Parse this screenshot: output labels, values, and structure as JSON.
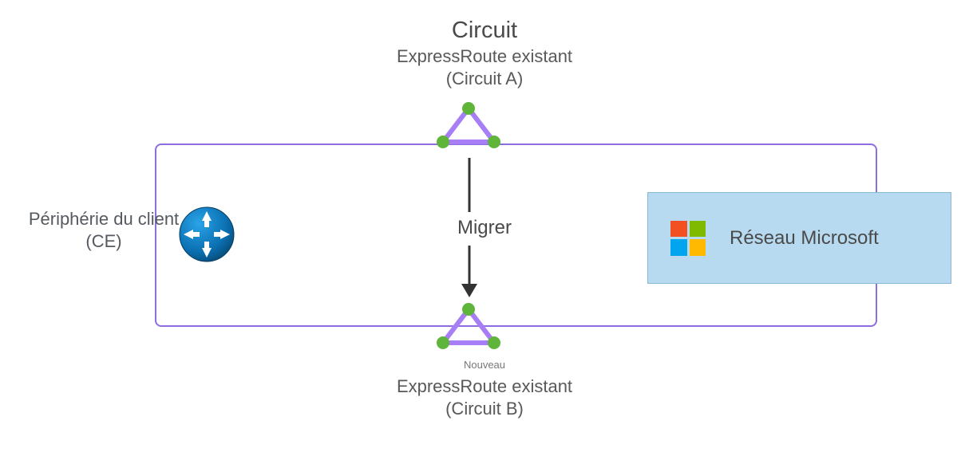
{
  "header": {
    "title": "Circuit",
    "subtitle": "ExpressRoute existant",
    "circuit_label": "(Circuit A)"
  },
  "footer": {
    "new_tag": "Nouveau",
    "subtitle": "ExpressRoute existant",
    "circuit_label": "(Circuit B)"
  },
  "center": {
    "migrate_label": "Migrer"
  },
  "left": {
    "line1": "Périphérie du client",
    "line2": "(CE)"
  },
  "right": {
    "ms_network_label": "Réseau Microsoft"
  },
  "icons": {
    "router": "router-icon",
    "expressroute_triangle_top": "expressroute-circuit-icon",
    "expressroute_triangle_bottom": "expressroute-circuit-icon",
    "microsoft_logo": "microsoft-logo-icon",
    "migrate_arrow": "arrow-down-icon"
  },
  "colors": {
    "border": "#8c6ee0",
    "triangle_stroke": "#a77ef5",
    "node_green": "#5fb43a",
    "ms_card_bg": "#b7daf0",
    "router_blue": "#0a84c6"
  }
}
